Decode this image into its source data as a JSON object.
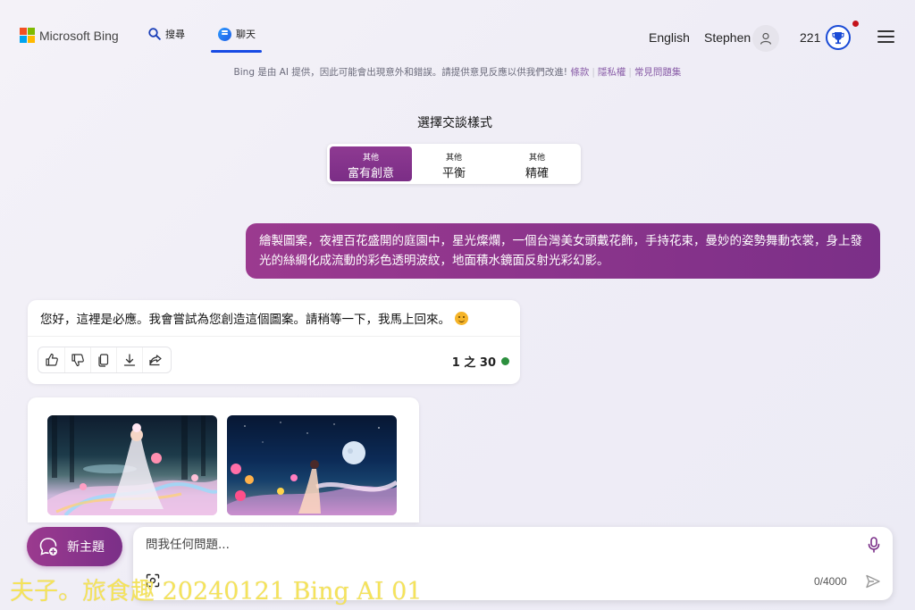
{
  "header": {
    "logo_text": "Microsoft Bing",
    "tab_search": "搜尋",
    "tab_chat": "聊天",
    "language": "English",
    "user_name": "Stephen",
    "reward_points": "221",
    "colors": {
      "logo": [
        "#f25022",
        "#7fba00",
        "#00a4ef",
        "#ffb900"
      ],
      "accent": "#174ae4"
    }
  },
  "disclaimer": {
    "text": "Bing 是由 AI 提供，因此可能會出現意外和錯誤。請提供意見反應以供我們改進!",
    "link_terms": "條款",
    "link_privacy": "隱私權",
    "link_faq": "常見問題集"
  },
  "style_selector": {
    "title": "選擇交談樣式",
    "options": [
      {
        "small": "其他",
        "label": "富有創意",
        "active": true
      },
      {
        "small": "其他",
        "label": "平衡",
        "active": false
      },
      {
        "small": "其他",
        "label": "精確",
        "active": false
      }
    ]
  },
  "conversation": {
    "user_message": "繪製圖案，夜裡百花盛開的庭園中，星光燦爛，一個台灣美女頭戴花飾，手持花束，曼妙的姿勢舞動衣裳，身上發光的絲綢化成流動的彩色透明波紋，地面積水鏡面反射光彩幻影。",
    "bot_message": "您好，這裡是必應。我會嘗試為您創造這個圖案。請稍等一下，我馬上回來。",
    "turn_counter": "1 之 30",
    "actions": [
      "thumbs-up-icon",
      "thumbs-down-icon",
      "copy-icon",
      "download-icon",
      "share-icon"
    ]
  },
  "composer": {
    "new_topic_label": "新主題",
    "input_placeholder": "問我任何問題...",
    "char_count": "0/4000"
  },
  "watermark": "夫子。旅食趣 20240121 Bing AI 01"
}
